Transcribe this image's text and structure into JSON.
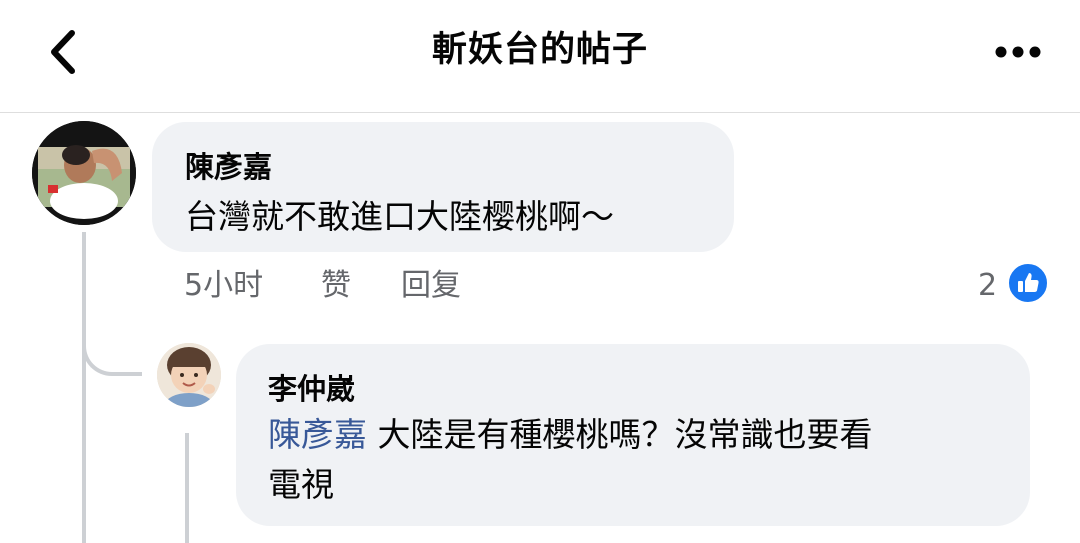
{
  "header": {
    "title": "斬妖台的帖子"
  },
  "comments": [
    {
      "author": "陳彥嘉",
      "text": "台灣就不敢進口大陸樱桃啊～",
      "time": "5小时",
      "like_label": "赞",
      "reply_label": "回复",
      "reaction_count": "2"
    }
  ],
  "replies": [
    {
      "author": "李仲崴",
      "mention": "陳彥嘉",
      "text_line1": " 大陸是有種櫻桃嗎？沒常識也要看",
      "text_line2": "電視"
    }
  ],
  "icons": {
    "back": "chevron-left-icon",
    "more": "more-horizontal-icon",
    "reaction": "thumbs-up-icon"
  },
  "colors": {
    "bubble": "#f0f2f5",
    "mention": "#385898",
    "like_blue": "#1877f2",
    "meta_gray": "#65676b"
  }
}
